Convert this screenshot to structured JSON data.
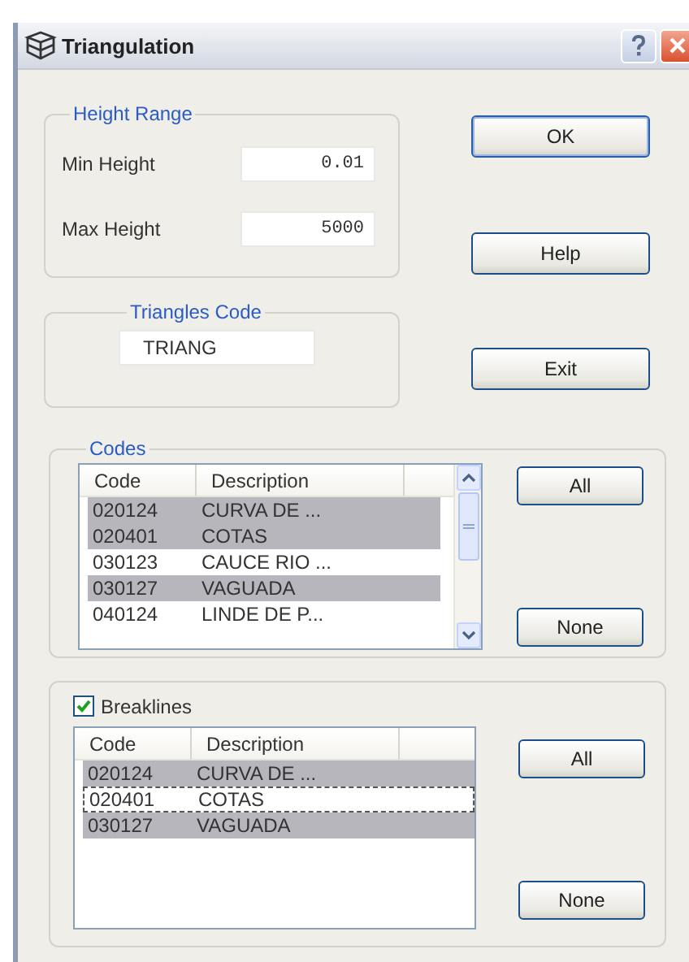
{
  "window": {
    "title": "Triangulation"
  },
  "height_range": {
    "title": "Height Range",
    "fields": [
      {
        "label": "Min Height",
        "value": "0.01"
      },
      {
        "label": "Max Height",
        "value": "5000"
      }
    ]
  },
  "triangles_code": {
    "title": "Triangles Code",
    "value": "TRIANG"
  },
  "buttons": [
    "OK",
    "Help",
    "Exit"
  ],
  "codes": {
    "title": "Codes",
    "columns": [
      "Code",
      "Description"
    ],
    "rows": [
      {
        "code": "020124",
        "description": "CURVA DE ...",
        "selected": true,
        "focused": false
      },
      {
        "code": "020401",
        "description": "COTAS",
        "selected": true,
        "focused": false
      },
      {
        "code": "030123",
        "description": "CAUCE RIO ...",
        "selected": false,
        "focused": false
      },
      {
        "code": "030127",
        "description": "VAGUADA",
        "selected": true,
        "focused": false
      },
      {
        "code": "040124",
        "description": "LINDE DE P...",
        "selected": false,
        "focused": false
      }
    ],
    "buttons": [
      "All",
      "None"
    ]
  },
  "breaklines": {
    "label": "Breaklines",
    "checked": true,
    "columns": [
      "Code",
      "Description"
    ],
    "rows": [
      {
        "code": "020124",
        "description": "CURVA DE ...",
        "selected": true,
        "focused": false
      },
      {
        "code": "020401",
        "description": "COTAS",
        "selected": false,
        "focused": true
      },
      {
        "code": "030127",
        "description": "VAGUADA",
        "selected": true,
        "focused": false
      }
    ],
    "buttons": [
      "All",
      "None"
    ]
  }
}
